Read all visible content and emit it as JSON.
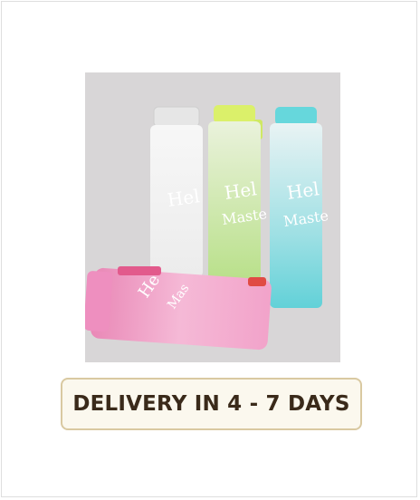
{
  "product": {
    "image_alt": "frosted glass water bottles in white, green, blue and pink",
    "bottle_lettering": "Hello Master",
    "colors": {
      "background": "#d8d6d7",
      "bottle_white": "#f2f2f2",
      "bottle_green": "#c7e59a",
      "bottle_blue": "#7fd9de",
      "bottle_pink": "#f3a9cf",
      "badge_border": "#d9c9a1",
      "badge_bg": "#fbf8ee",
      "badge_text": "#3a2a1a"
    }
  },
  "delivery_badge": {
    "text": "DELIVERY IN 4 - 7 DAYS"
  }
}
